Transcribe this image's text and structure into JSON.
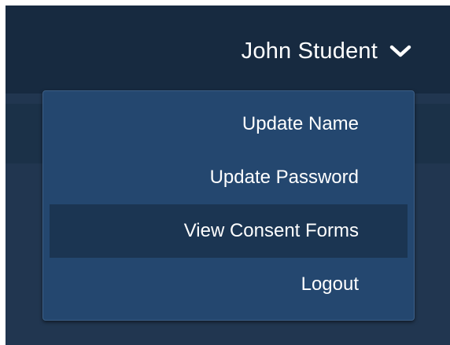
{
  "header": {
    "user_name": "John Student",
    "toggle_icon": "chevron-down-icon"
  },
  "dropdown": {
    "items": [
      {
        "label": "Update Name"
      },
      {
        "label": "Update Password"
      },
      {
        "label": "View Consent Forms",
        "highlighted": true
      },
      {
        "label": "Logout"
      }
    ]
  },
  "colors": {
    "header_background": "#172a40",
    "page_background": "#213650",
    "dropdown_background": "#24476f",
    "highlight_background": "#1b3552",
    "text": "#ffffff"
  }
}
